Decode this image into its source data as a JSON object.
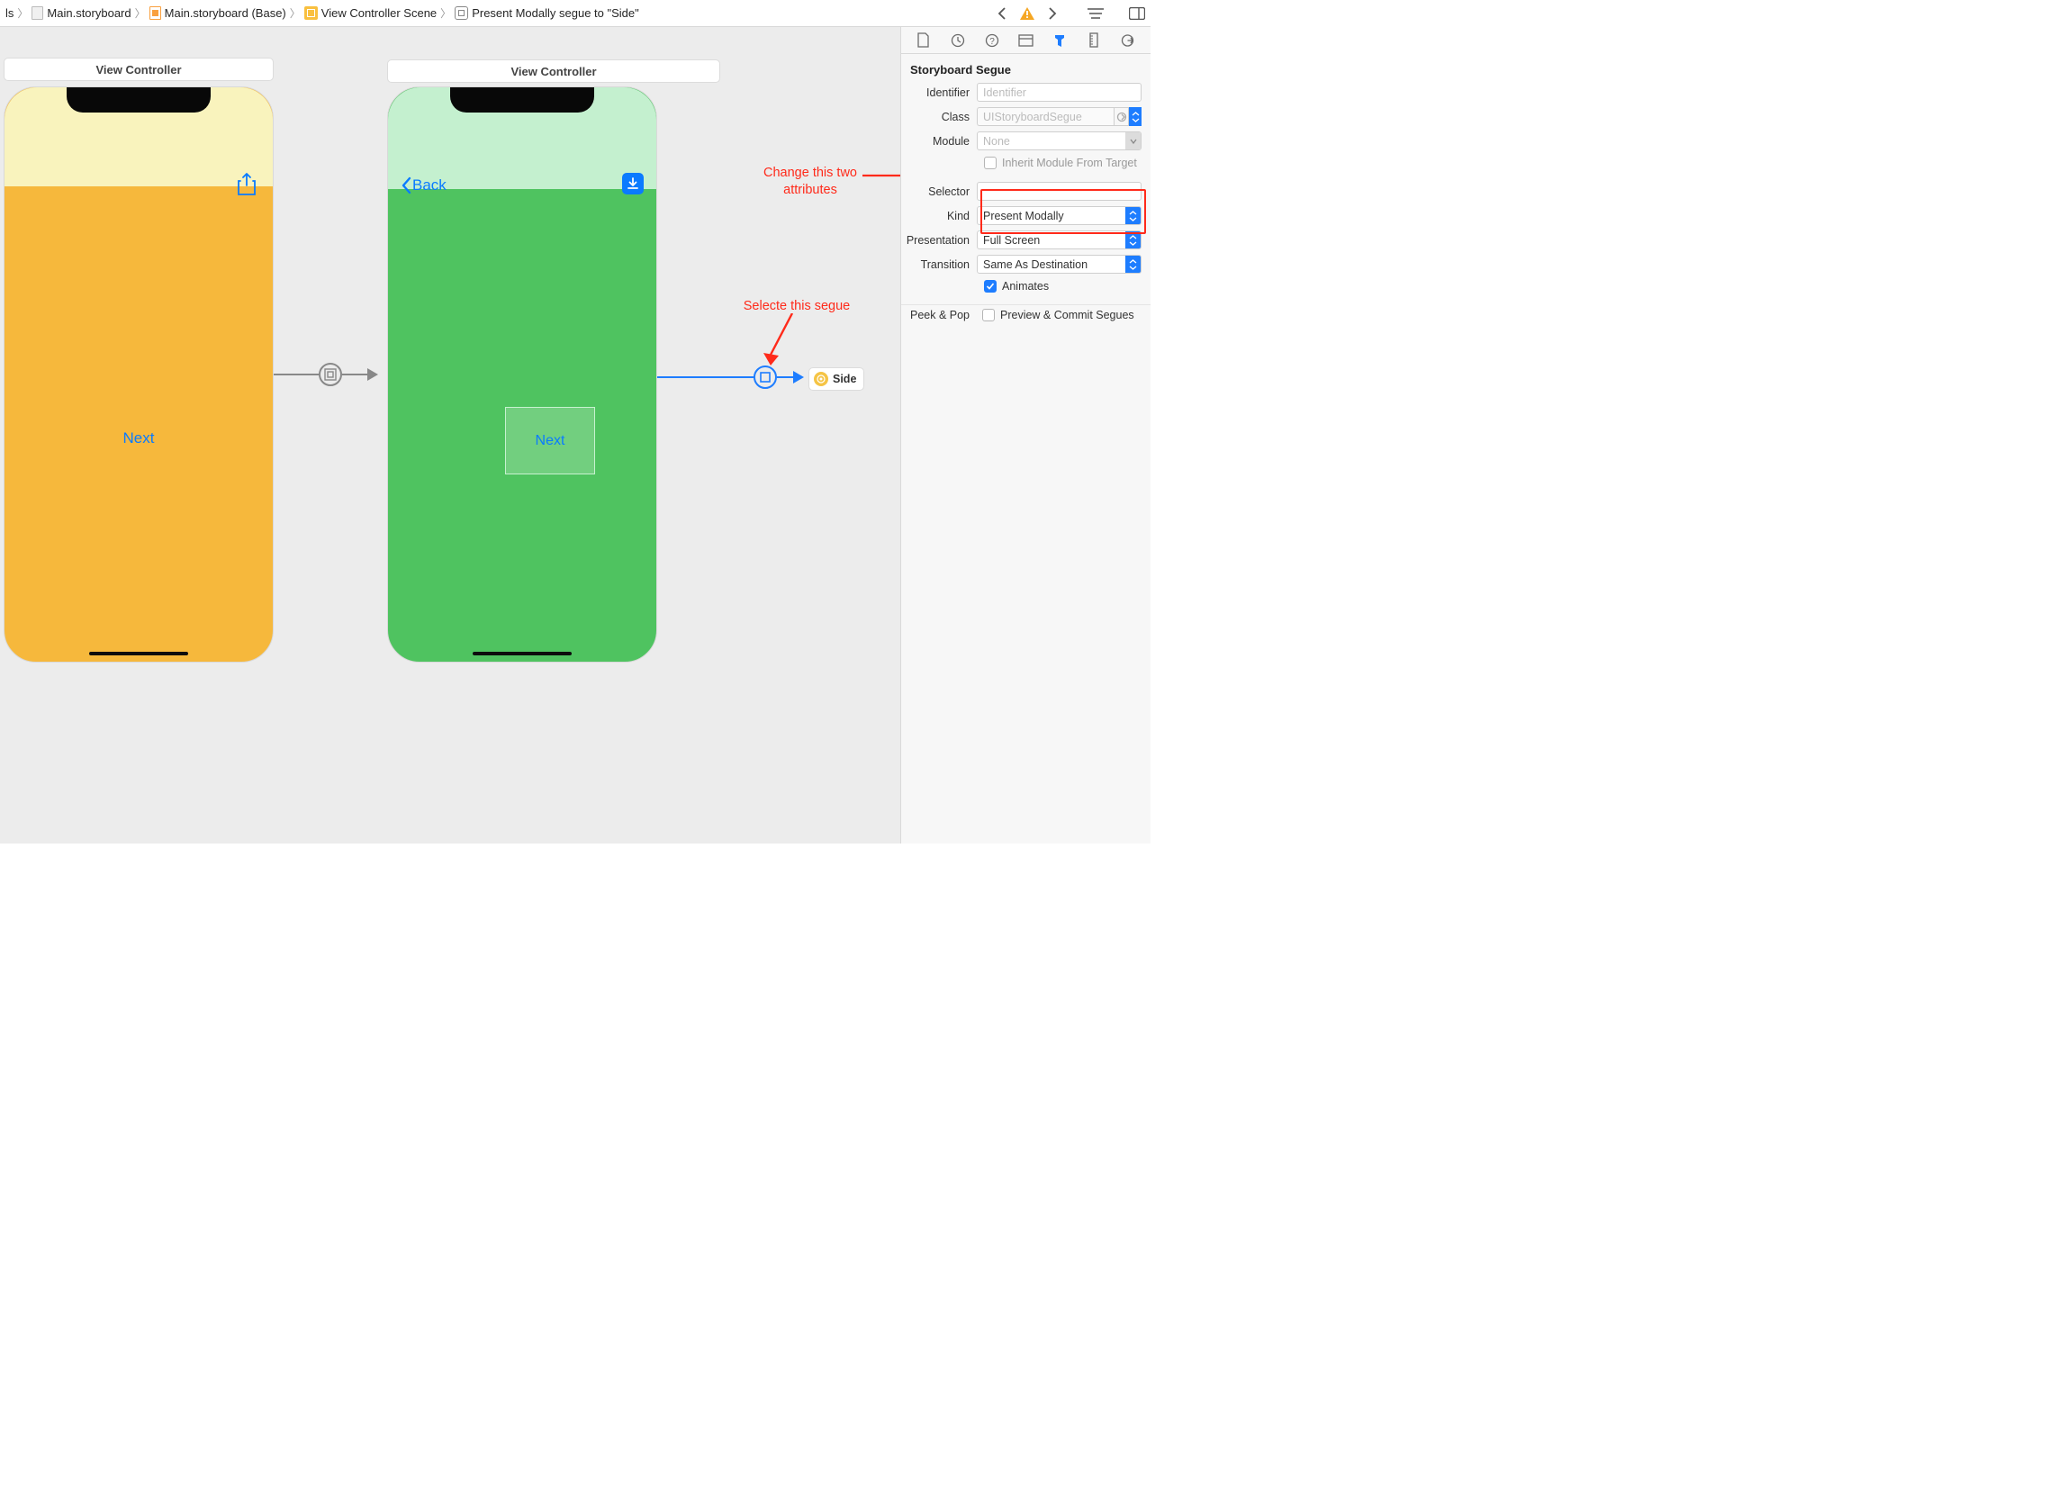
{
  "breadcrumb": {
    "items": [
      {
        "label": "ls"
      },
      {
        "label": "Main.storyboard"
      },
      {
        "label": "Main.storyboard (Base)"
      },
      {
        "label": "View Controller Scene"
      },
      {
        "label": "Present Modally segue to \"Side\""
      }
    ]
  },
  "scenes": {
    "left_title": "View Controller",
    "right_title": "View Controller",
    "back_label": "Back",
    "next_label1": "Next",
    "next_label2": "Next",
    "side_chip": "Side"
  },
  "annotations": {
    "attrs_line1": "Change this two",
    "attrs_line2": "attributes",
    "segue_line": "Selecte this segue"
  },
  "inspector": {
    "section_title": "Storyboard Segue",
    "identifier_label": "Identifier",
    "identifier_placeholder": "Identifier",
    "class_label": "Class",
    "class_value": "UIStoryboardSegue",
    "module_label": "Module",
    "module_value": "None",
    "inherit_label": "Inherit Module From Target",
    "selector_label": "Selector",
    "selector_value": "",
    "kind_label": "Kind",
    "kind_value": "Present Modally",
    "presentation_label": "Presentation",
    "presentation_value": "Full Screen",
    "transition_label": "Transition",
    "transition_value": "Same As Destination",
    "animates_label": "Animates",
    "peek_label": "Peek & Pop",
    "preview_label": "Preview & Commit Segues"
  }
}
